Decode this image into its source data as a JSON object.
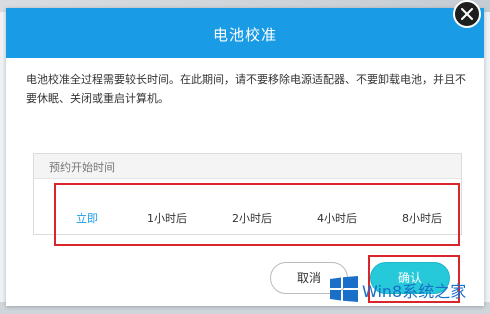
{
  "dialog": {
    "title": "电池校准",
    "message": "电池校准全过程需要较长时间。在此期间，请不要移除电源适配器、不要卸载电池，并且不要休眠、关闭或重启计算机。"
  },
  "schedule": {
    "label": "预约开始时间",
    "options": [
      "立即",
      "1小时后",
      "2小时后",
      "4小时后",
      "8小时后"
    ],
    "selected": "立即"
  },
  "buttons": {
    "cancel": "取消",
    "confirm": "确认"
  },
  "watermark": {
    "text": "Win8系统之家"
  },
  "colors": {
    "accent": "#1a9be6",
    "confirm": "#26c9d9",
    "highlight": "#d9262b"
  }
}
